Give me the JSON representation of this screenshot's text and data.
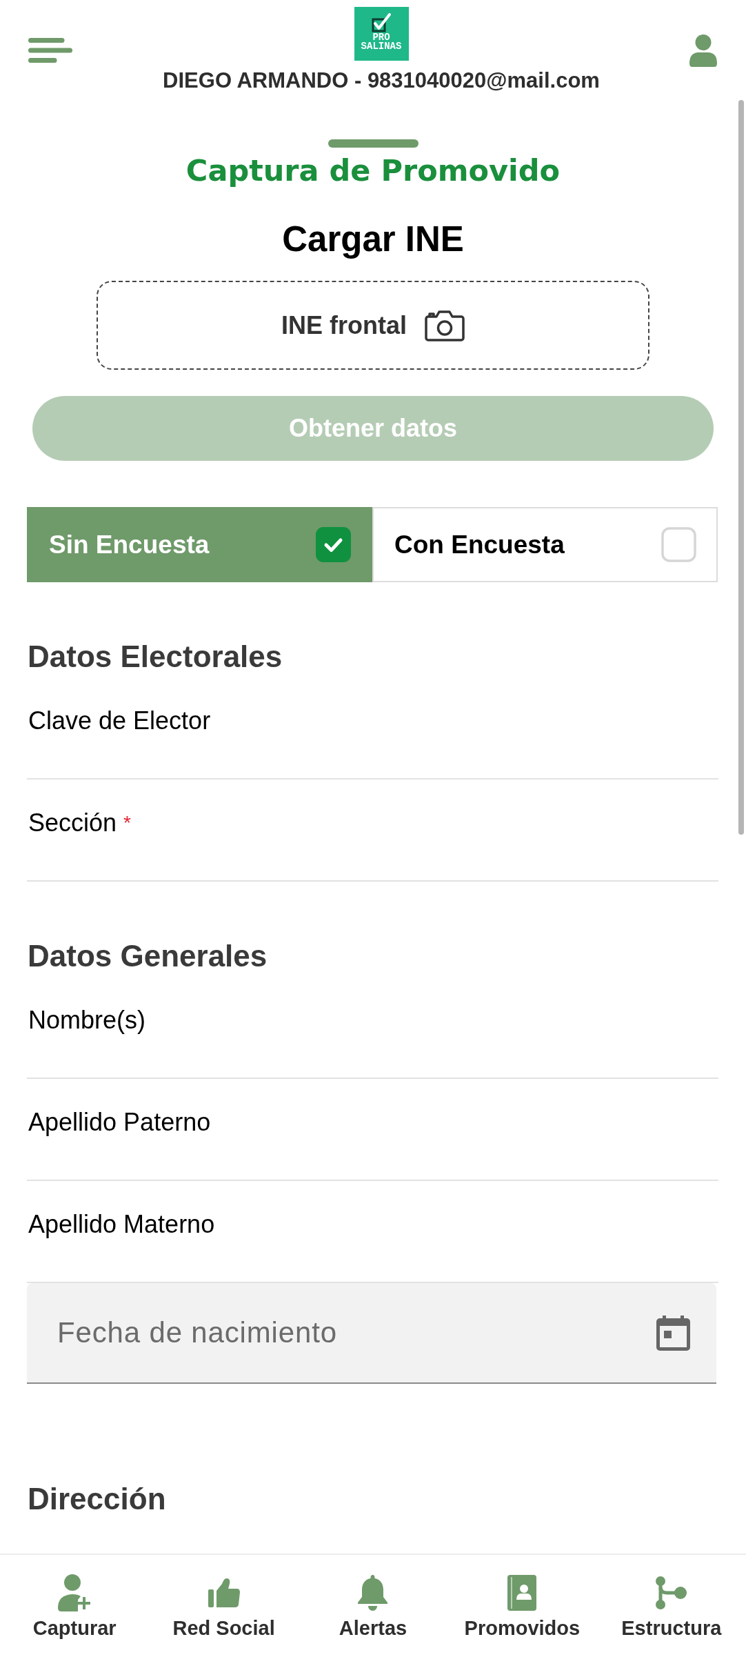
{
  "header": {
    "logo": {
      "line_1": "PRO",
      "line_2": "SALINAS"
    },
    "user_label": "DIEGO ARMANDO - 9831040020@mail.com"
  },
  "sheet": {
    "title": "Captura de Promovido",
    "upload_heading": "Cargar INE",
    "dropzone_label": "INE frontal",
    "fetch_button": {
      "label": "Obtener datos",
      "disabled": true
    }
  },
  "survey_options": [
    {
      "label": "Sin Encuesta",
      "selected": true
    },
    {
      "label": "Con Encuesta",
      "selected": false
    }
  ],
  "sections": [
    {
      "title": "Datos Electorales",
      "fields": [
        {
          "kind": "text",
          "label": "Clave de Elector"
        },
        {
          "kind": "text",
          "label": "Sección",
          "required_mark": "*"
        }
      ]
    },
    {
      "title": "Datos Generales",
      "fields": [
        {
          "kind": "text",
          "label": "Nombre(s)"
        },
        {
          "kind": "text",
          "label": "Apellido Paterno"
        },
        {
          "kind": "text",
          "label": "Apellido Materno"
        },
        {
          "kind": "date",
          "placeholder": "Fecha de nacimiento"
        }
      ]
    },
    {
      "title": "Dirección"
    }
  ],
  "bottom_nav": [
    {
      "label": "Capturar"
    },
    {
      "label": "Red Social"
    },
    {
      "label": "Alertas"
    },
    {
      "label": "Promovidos"
    },
    {
      "label": "Estructura"
    }
  ]
}
